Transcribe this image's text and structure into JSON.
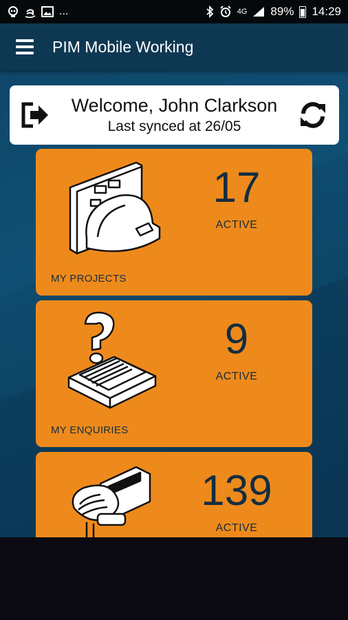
{
  "status_bar": {
    "time": "14:29",
    "battery": "89%",
    "network": "4G",
    "more": "...",
    "icons": [
      "notification-icon",
      "amazon-icon",
      "image-icon",
      "bluetooth-icon",
      "alarm-icon",
      "signal-icon",
      "battery-icon"
    ]
  },
  "app_bar": {
    "title": "PIM Mobile Working"
  },
  "welcome": {
    "title": "Welcome, John Clarkson",
    "subtitle": "Last synced at 26/05"
  },
  "tiles": [
    {
      "count": "17",
      "status": "ACTIVE",
      "label": "MY PROJECTS",
      "icon": "projects-icon"
    },
    {
      "count": "9",
      "status": "ACTIVE",
      "label": "MY ENQUIRIES",
      "icon": "enquiries-icon"
    },
    {
      "count": "139",
      "status": "ACTIVE",
      "label": "",
      "icon": "contacts-icon"
    }
  ],
  "colors": {
    "status_bar": "#06090c",
    "app_bar": "#0e3852",
    "tile": "#ee8a1c",
    "tile_text": "#142d40",
    "background": "#12577d"
  }
}
